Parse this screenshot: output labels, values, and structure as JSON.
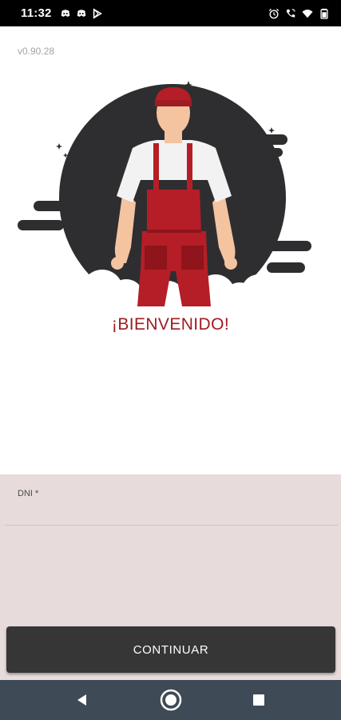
{
  "status_bar": {
    "time": "11:32",
    "left_icons": [
      "discord-icon",
      "discord-icon",
      "play-store-icon"
    ],
    "right_icons": [
      "alarm-icon",
      "wifi-calling-icon",
      "wifi-icon",
      "battery-icon"
    ]
  },
  "app": {
    "version": "v0.90.28",
    "welcome_title": "¡BIENVENIDO!",
    "hero_image": "worker-overalls-illustration"
  },
  "form": {
    "dni_label": "DNI *",
    "dni_value": "",
    "continue_label": "CONTINUAR"
  },
  "colors": {
    "accent": "#9e1c22",
    "button": "#363636",
    "form_bg": "#e7dbdb",
    "nav_bg": "#3e4a55"
  },
  "nav_bar": {
    "buttons": [
      "back-icon",
      "home-icon",
      "recents-icon"
    ]
  }
}
